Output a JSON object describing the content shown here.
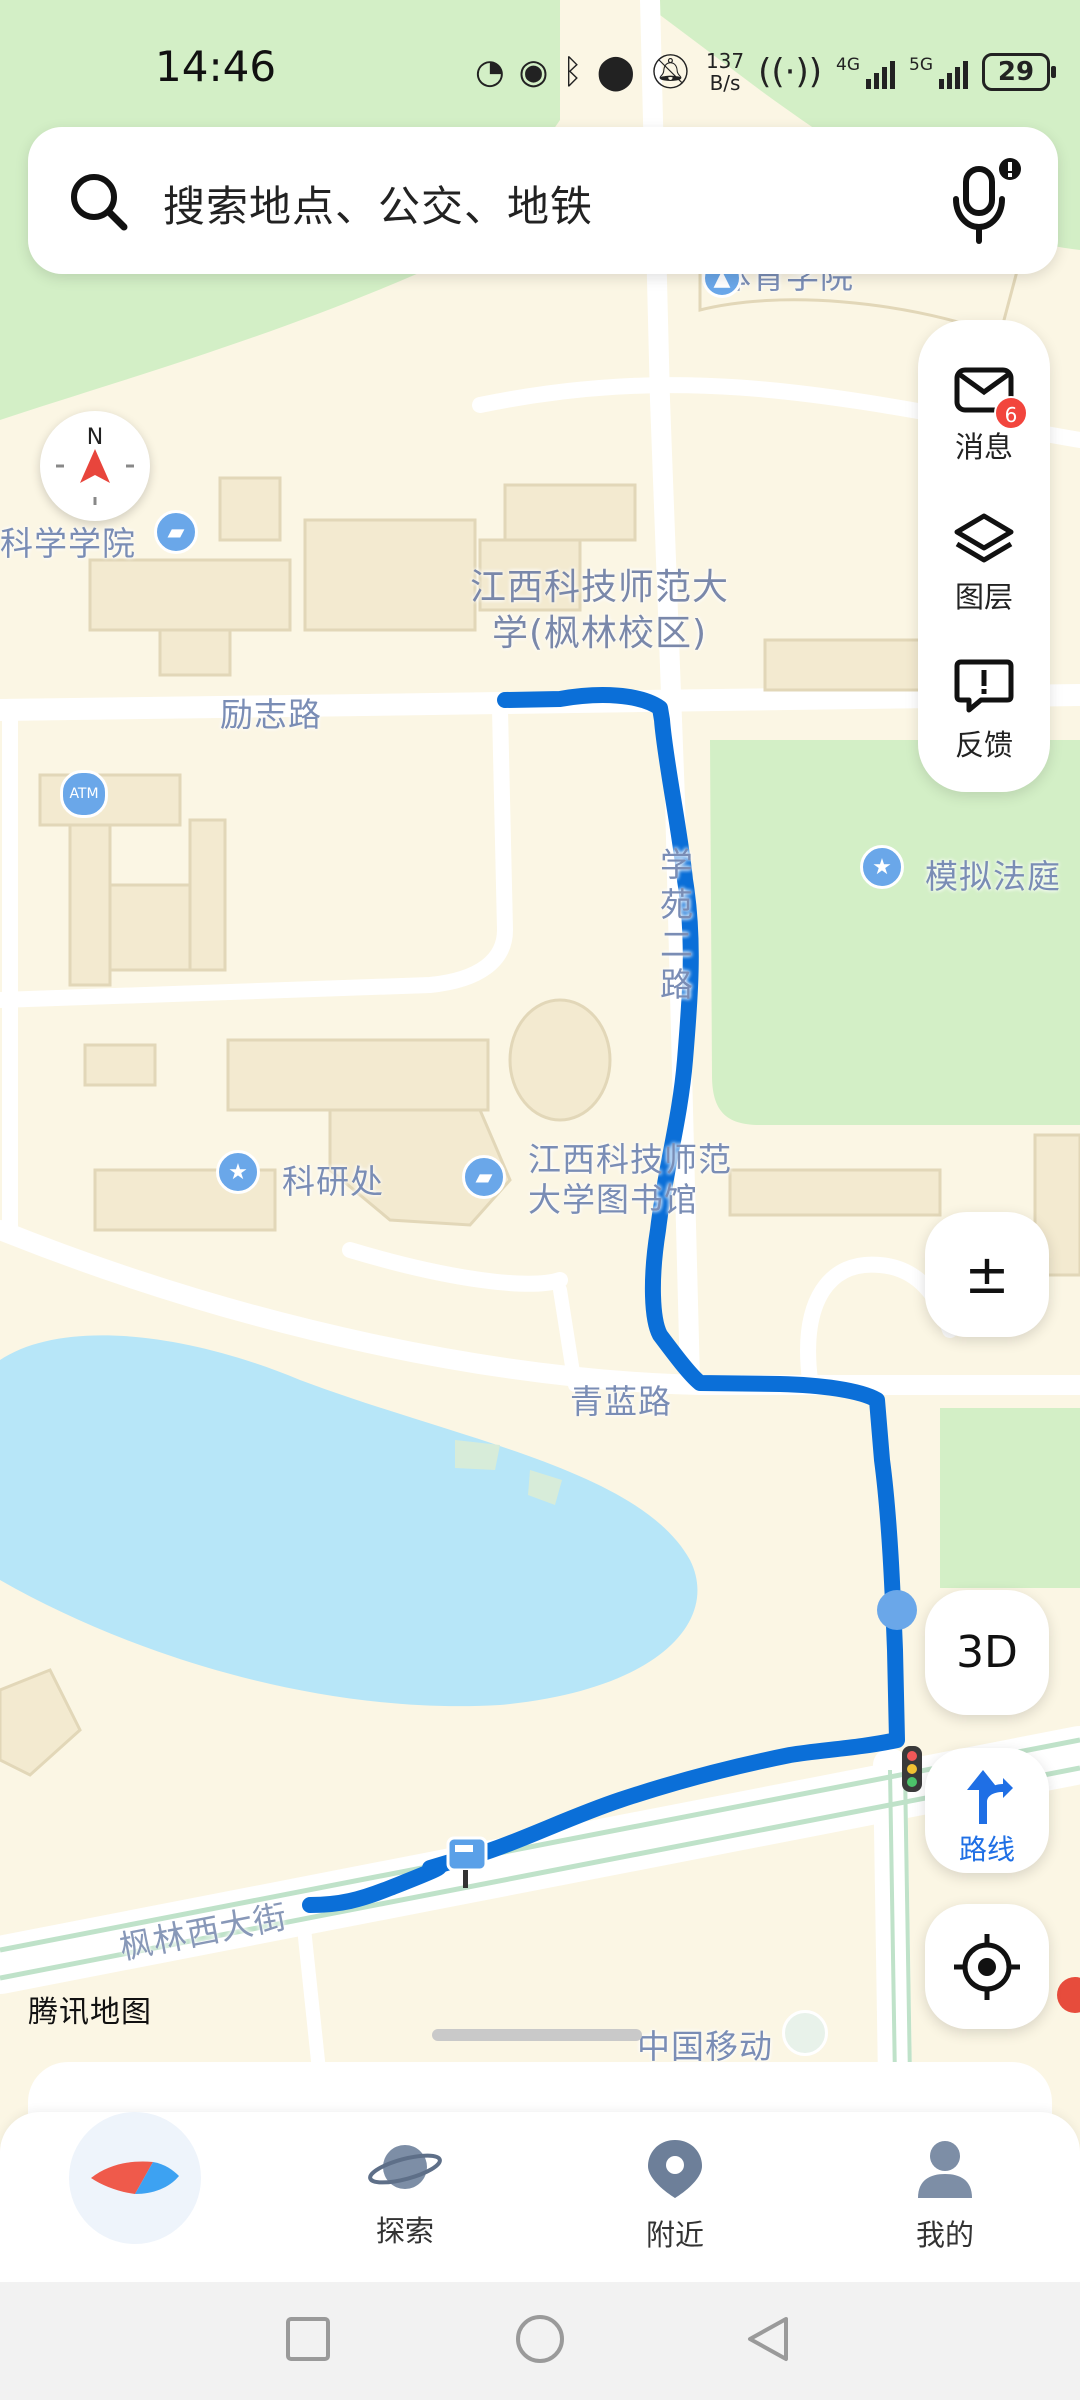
{
  "status_bar": {
    "time": "14:46",
    "net_speed_value": "137",
    "net_speed_unit": "B/s",
    "network_1": "4G",
    "network_2": "5G",
    "hotspot_count": "1",
    "battery": "29"
  },
  "search": {
    "placeholder": "搜索地点、公交、地铁"
  },
  "compass": {
    "north_label": "N"
  },
  "side_panel": {
    "messages_label": "消息",
    "messages_badge": "6",
    "layers_label": "图层",
    "feedback_label": "反馈"
  },
  "controls": {
    "zoom_label": "±",
    "three_d_label": "3D",
    "route_label": "路线"
  },
  "map": {
    "labels": {
      "campus": "江西科技师范大\n学(枫林校区)",
      "academy": "科学学院",
      "lizhi_road": "励志路",
      "mock_court": "模拟法庭",
      "research_office": "科研处",
      "library": "江西科技师范\n大学图书馆",
      "qinglan_road": "青蓝路",
      "fenglin_street": "枫林西大街",
      "china_mobile": "中国移动",
      "xueyuan_road": "学\n苑\n二\n路",
      "sports_academy": "体育学院",
      "atm": "ATM"
    },
    "provider": "腾讯地图"
  },
  "bottom_nav": {
    "items": [
      {
        "label": ""
      },
      {
        "label": "探索"
      },
      {
        "label": "附近"
      },
      {
        "label": "我的"
      }
    ]
  },
  "colors": {
    "route": "#0b6fd8",
    "water": "#b7e6f8",
    "park": "#d3efc6",
    "land": "#fbf6e4",
    "road": "#ffffff",
    "building": "#f3ead0",
    "accent": "#1f6fe5",
    "badge": "#f2453d"
  }
}
